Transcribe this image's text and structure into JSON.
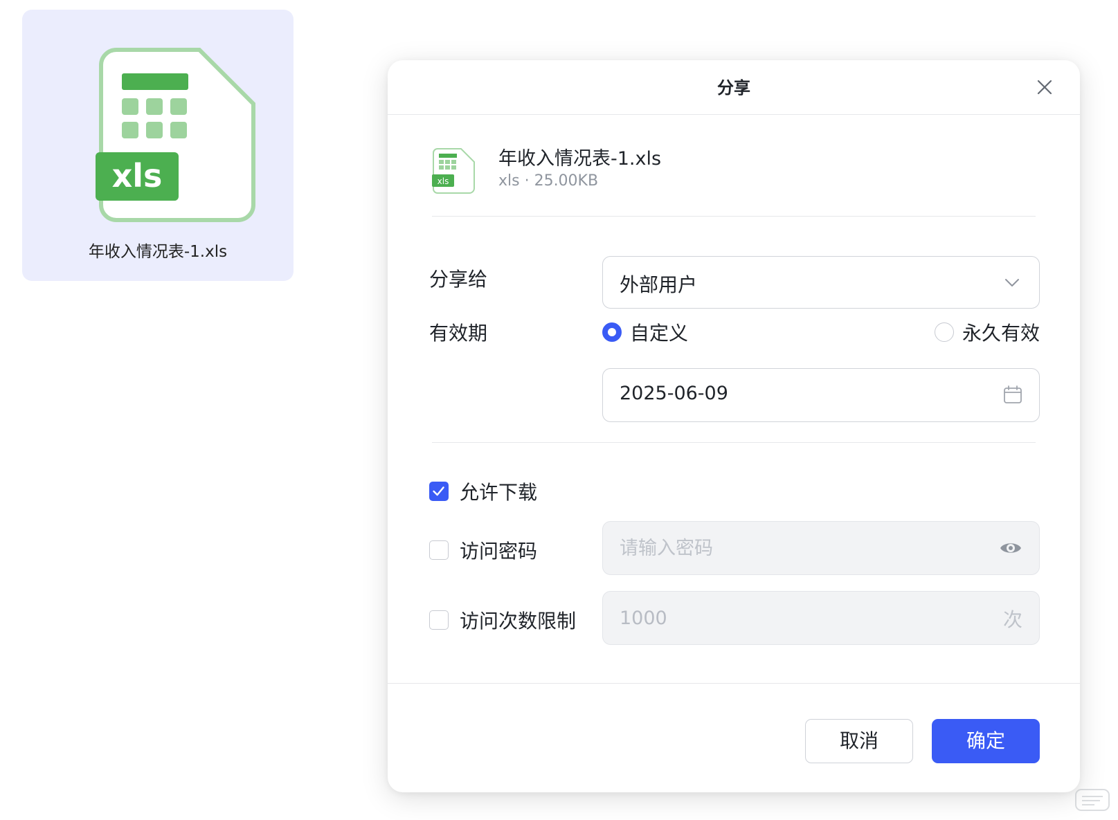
{
  "tile": {
    "file_name": "年收入情况表-1.xls",
    "badge": "xls"
  },
  "dialog": {
    "title": "分享",
    "file": {
      "name": "年收入情况表-1.xls",
      "meta": "xls · 25.00KB",
      "badge": "xls"
    },
    "share_to": {
      "label": "分享给",
      "value": "外部用户"
    },
    "validity": {
      "label": "有效期",
      "option_custom": "自定义",
      "option_permanent": "永久有效",
      "selected": "custom",
      "date": "2025-06-09"
    },
    "allow_download": {
      "label": "允许下载",
      "checked": true
    },
    "access_password": {
      "label": "访问密码",
      "checked": false,
      "placeholder": "请输入密码"
    },
    "access_limit": {
      "label": "访问次数限制",
      "checked": false,
      "value": "1000",
      "unit": "次"
    },
    "cancel_label": "取消",
    "ok_label": "确定"
  },
  "colors": {
    "accent": "#3a5bf5",
    "xls_green": "#4caf50",
    "tile_bg": "#ebedfd"
  },
  "icons": [
    "xls-file-icon",
    "close-icon",
    "chevron-down-icon",
    "calendar-icon",
    "eye-icon",
    "check-icon"
  ]
}
